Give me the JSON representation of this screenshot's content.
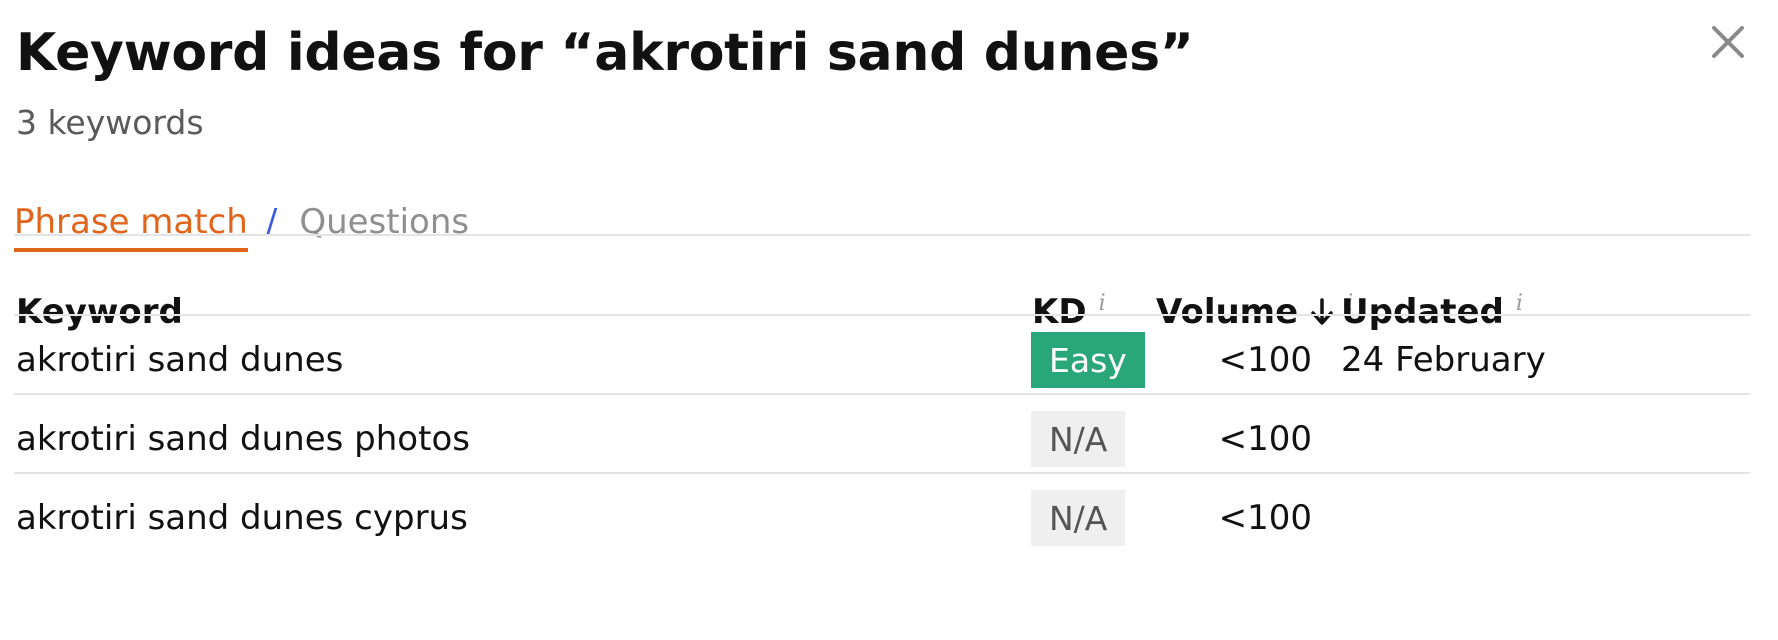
{
  "dialog": {
    "title": "Keyword ideas for “akrotiri sand dunes”",
    "subtitle": "3 keywords",
    "close_icon": "close-icon"
  },
  "tabs": {
    "active_label": "Phrase match",
    "separator": "/",
    "inactive_label": "Questions"
  },
  "table": {
    "columns": {
      "keyword": "Keyword",
      "kd": "KD",
      "volume": "Volume",
      "updated": "Updated",
      "info_glyph": "i",
      "sort_icon": "arrow-down-icon",
      "sort_direction": "descending"
    },
    "rows": [
      {
        "keyword": "akrotiri sand dunes",
        "kd": "Easy",
        "volume": "<100",
        "updated": "24 February"
      },
      {
        "keyword": "akrotiri sand dunes photos",
        "kd": "N/A",
        "volume": "<100",
        "updated": ""
      },
      {
        "keyword": "akrotiri sand dunes cyprus",
        "kd": "N/A",
        "volume": "<100",
        "updated": ""
      }
    ]
  },
  "colors": {
    "active_tab": "#e0651b",
    "separator": "#3b5bdb",
    "kd_easy": "#2aa77a",
    "kd_na": "#efefef"
  }
}
